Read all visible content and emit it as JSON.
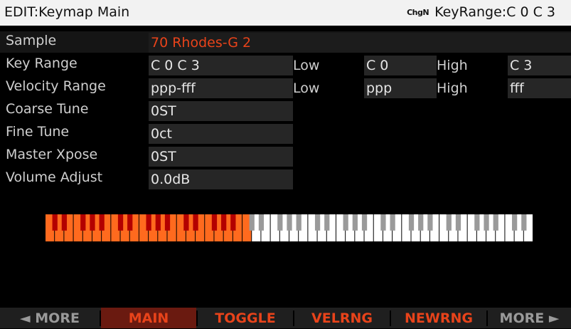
{
  "titlebar": {
    "left": "EDIT:Keymap Main",
    "icon_text": "ChgN",
    "right": "KeyRange:C 0 C 3"
  },
  "params": {
    "sample": {
      "label": "Sample",
      "value": "70 Rhodes-G 2"
    },
    "key_range": {
      "label": "Key Range",
      "value": "C 0 C 3",
      "low_label": "Low",
      "low": "C 0",
      "high_label": "High",
      "high": "C 3"
    },
    "velocity_range": {
      "label": "Velocity Range",
      "value": "ppp-fff",
      "low_label": "Low",
      "low": "ppp",
      "high_label": "High",
      "high": "fff"
    },
    "coarse_tune": {
      "label": "Coarse Tune",
      "value": "0ST"
    },
    "fine_tune": {
      "label": "Fine Tune",
      "value": "0ct"
    },
    "master_xpose": {
      "label": "Master Xpose",
      "value": "0ST"
    },
    "volume_adjust": {
      "label": "Volume Adjust",
      "value": "0.0dB"
    }
  },
  "keyboard": {
    "white_keys": 52,
    "selected_white_keys": 22,
    "selected_color": "#ff6a1e",
    "unselected_color": "#ffffff"
  },
  "softbuttons": {
    "more_left": "◄ MORE",
    "main": "MAIN",
    "toggle": "TOGGLE",
    "velrng": "VELRNG",
    "newrng": "NEWRNG",
    "more_right": "MORE ►"
  },
  "colors": {
    "accent": "#e8431a",
    "panel": "#262626",
    "active_tab": "#6a1a10"
  }
}
